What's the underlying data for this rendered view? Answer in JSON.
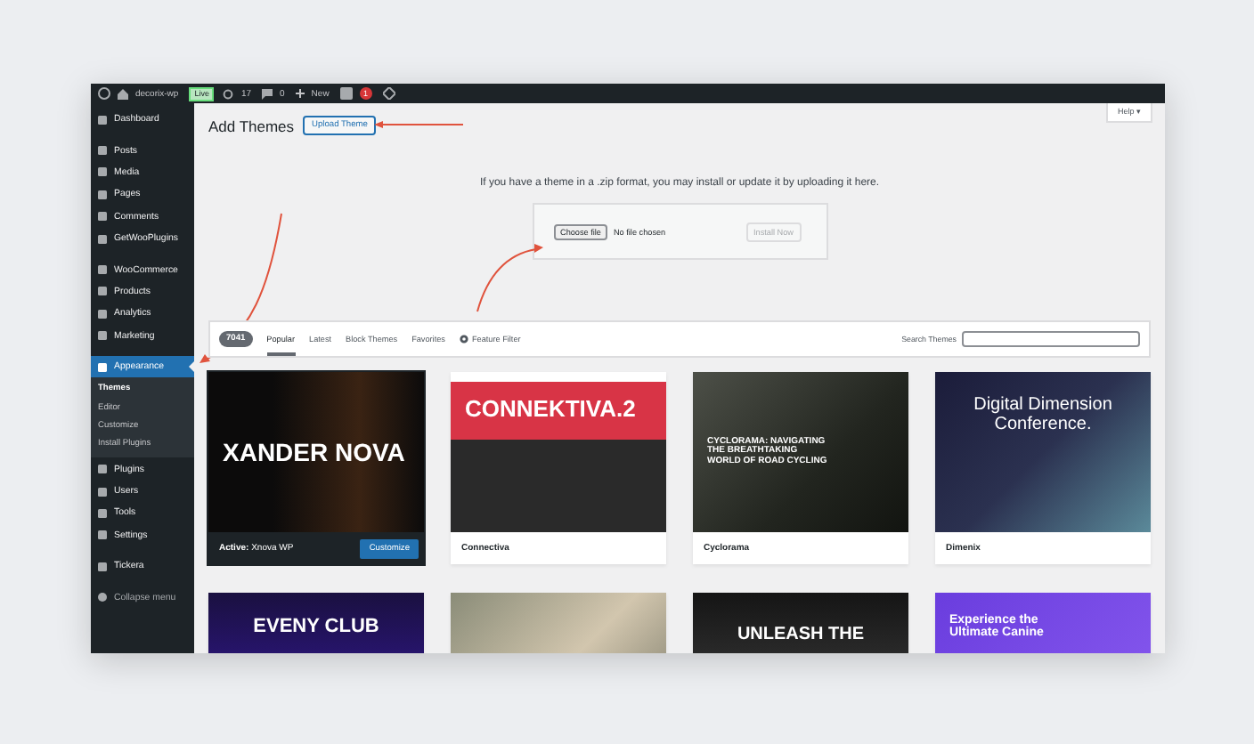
{
  "admin_bar": {
    "site_name": "decorix-wp",
    "live_badge": "Live",
    "updates_count": "17",
    "comments_count": "0",
    "new_label": "New",
    "notification_count": "1"
  },
  "sidebar": {
    "groups": [
      [
        {
          "label": "Dashboard",
          "selected": false
        }
      ],
      [
        {
          "label": "Posts",
          "selected": false
        },
        {
          "label": "Media",
          "selected": false
        },
        {
          "label": "Pages",
          "selected": false
        },
        {
          "label": "Comments",
          "selected": false
        },
        {
          "label": "GetWooPlugins",
          "selected": false
        }
      ],
      [
        {
          "label": "WooCommerce",
          "selected": false
        },
        {
          "label": "Products",
          "selected": false
        },
        {
          "label": "Analytics",
          "selected": false
        },
        {
          "label": "Marketing",
          "selected": false
        }
      ],
      [
        {
          "label": "Appearance",
          "selected": true,
          "children": [
            {
              "label": "Themes",
              "selected": true
            },
            {
              "label": "Editor",
              "selected": false
            },
            {
              "label": "Customize",
              "selected": false
            },
            {
              "label": "Install Plugins",
              "selected": false
            }
          ]
        },
        {
          "label": "Plugins",
          "selected": false
        },
        {
          "label": "Users",
          "selected": false
        },
        {
          "label": "Tools",
          "selected": false
        },
        {
          "label": "Settings",
          "selected": false
        }
      ],
      [
        {
          "label": "Tickera",
          "selected": false
        }
      ]
    ],
    "collapse_label": "Collapse menu"
  },
  "help_tab": "Help ▾",
  "page_title": "Add Themes",
  "upload_button": "Upload Theme",
  "upload_text": "If you have a theme in a .zip format, you may install or update it by uploading it here.",
  "upload_form": {
    "choose_button": "Choose file",
    "file_status": "No file chosen",
    "install_button": "Install Now",
    "install_disabled": true
  },
  "filter_bar": {
    "count": "7041",
    "tabs": [
      {
        "label": "Popular",
        "selected": true
      },
      {
        "label": "Latest",
        "selected": false
      },
      {
        "label": "Block Themes",
        "selected": false
      },
      {
        "label": "Favorites",
        "selected": false
      }
    ],
    "feature_filter": "Feature Filter",
    "search_label": "Search Themes"
  },
  "themes": [
    {
      "name": "**Active:** Xnova WP",
      "active": true,
      "customize_button": "Customize",
      "preview_text": "XANDER NOVA"
    },
    {
      "name": "Connectiva",
      "active": false,
      "preview_text": "CONNEKTIVA.2"
    },
    {
      "name": "Cyclorama",
      "active": false,
      "preview_text": "CYCLORAMA: NAVIGATING THE BREATHTAKING WORLD OF ROAD CYCLING"
    },
    {
      "name": "Dimenix",
      "active": false,
      "preview_text": "Digital Dimension Conference."
    },
    {
      "preview_text": "EVENY CLUB"
    },
    {
      "kind": "photo"
    },
    {
      "preview_text": "UNLEASH THE"
    },
    {
      "preview_text": "Experience the Ultimate Canine"
    }
  ]
}
